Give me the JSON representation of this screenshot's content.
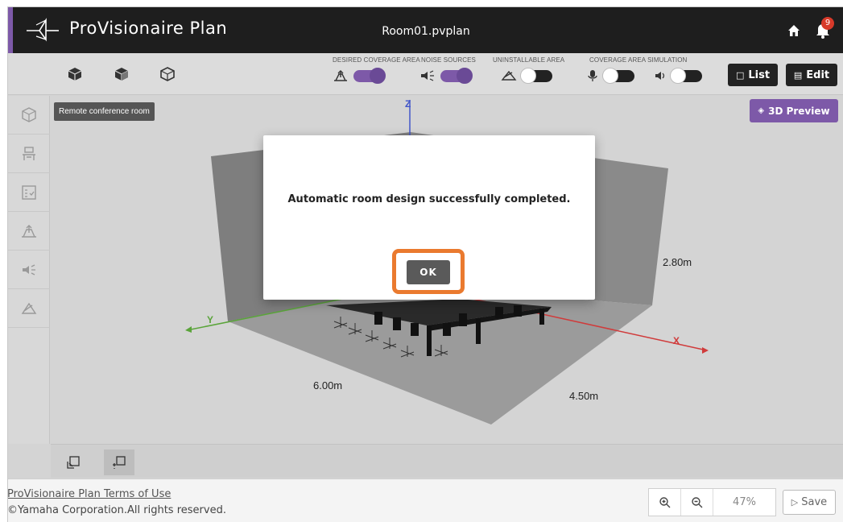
{
  "app": {
    "name": "ProVisionaire Plan",
    "file_name": "Room01.pvplan",
    "notifications_count": "9",
    "accent_color": "#7d59a8"
  },
  "toolbar": {
    "view_icons": [
      "cube-front-icon",
      "cube-side-icon",
      "cube-top-icon"
    ],
    "groups": [
      {
        "label": "DESIRED COVERAGE AREA",
        "icon": "coverage-area-icon",
        "on": true
      },
      {
        "label": "NOISE SOURCES",
        "icon": "noise-speaker-icon",
        "on": true
      },
      {
        "label": "UNINSTALLABLE AREA",
        "icon": "uninstallable-icon",
        "on": false
      },
      {
        "label": "COVERAGE AREA SIMULATION",
        "icon": "mic-icon",
        "on": false,
        "second_icon": "speaker-icon",
        "second_on": false
      }
    ],
    "list_label": "List",
    "edit_label": "Edit"
  },
  "sidebar": {
    "items": [
      "room-3d-icon",
      "furniture-icon",
      "checklist-icon",
      "coverage-area-icon",
      "noise-speaker-icon",
      "uninstallable-icon"
    ]
  },
  "canvas": {
    "room_name": "Remote conference room",
    "preview_label": "3D Preview",
    "dim_height": "2.80m",
    "dim_length": "6.00m",
    "dim_width": "4.50m",
    "axis_x": "X",
    "axis_y": "Y",
    "axis_z": "Z"
  },
  "modal": {
    "message": "Automatic room design successfully completed.",
    "ok_label": "OK",
    "highlight_color": "#ea7a2f"
  },
  "footer": {
    "terms_link": "ProVisionaire Plan Terms of Use",
    "copyright": "©Yamaha Corporation.All rights reserved.",
    "zoom_value": "47%",
    "save_label": "Save"
  }
}
